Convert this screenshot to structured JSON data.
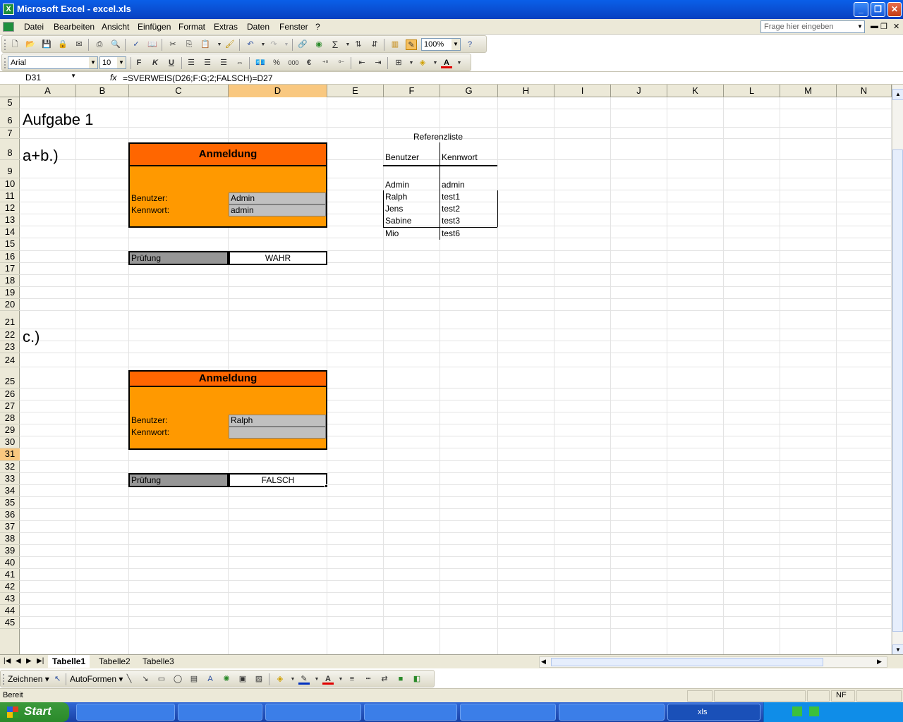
{
  "window": {
    "title": "Microsoft Excel - excel.xls",
    "icon": "excel-icon"
  },
  "menubar": {
    "items": [
      "Datei",
      "Bearbeiten",
      "Ansicht",
      "Einfügen",
      "Format",
      "Extras",
      "Daten",
      "Fenster",
      "?"
    ],
    "help_placeholder": "Frage hier eingeben"
  },
  "toolbar": {
    "zoom": "100%",
    "font": "Arial",
    "size": "10",
    "bold": "F",
    "italic": "K",
    "underline": "U",
    "percent": "%",
    "thousands": "000",
    "euro": "€"
  },
  "formula_bar": {
    "name_box": "D31",
    "fx": "fx",
    "formula": "=SVERWEIS(D26;F:G;2;FALSCH)=D27"
  },
  "columns": [
    "A",
    "B",
    "C",
    "D",
    "E",
    "F",
    "G",
    "H",
    "I",
    "J",
    "K",
    "L",
    "M",
    "N"
  ],
  "active_column": "D",
  "rows": [
    "5",
    "6",
    "7",
    "8",
    "9",
    "10",
    "11",
    "12",
    "13",
    "14",
    "15",
    "16",
    "17",
    "18",
    "19",
    "20",
    "21",
    "22",
    "23",
    "24",
    "25",
    "26",
    "27",
    "28",
    "29",
    "30",
    "31",
    "32",
    "33",
    "34",
    "35",
    "36",
    "37",
    "38",
    "39",
    "40",
    "41",
    "42",
    "43",
    "44",
    "45"
  ],
  "active_row": "31",
  "sheet": {
    "heading": "Aufgabe 1",
    "part_ab": "a+b.)",
    "part_c": "c.)",
    "login1": {
      "title": "Anmeldung",
      "user_label": "Benutzer:",
      "pass_label": "Kennwort:",
      "user_value": "Admin",
      "pass_value": "admin"
    },
    "check1": {
      "label": "Prüfung",
      "value": "WAHR"
    },
    "login2": {
      "title": "Anmeldung",
      "user_label": "Benutzer:",
      "pass_label": "Kennwort:",
      "user_value": "Ralph",
      "pass_value": ""
    },
    "check2": {
      "label": "Prüfung",
      "value": "FALSCH"
    },
    "reference": {
      "title": "Referenzliste",
      "headers": [
        "Benutzer",
        "Kennwort"
      ],
      "rows": [
        [
          "Admin",
          "admin"
        ],
        [
          "Ralph",
          "test1"
        ],
        [
          "Jens",
          "test2"
        ],
        [
          "Sabine",
          "test3"
        ],
        [
          "Mio",
          "test6"
        ]
      ]
    }
  },
  "tabs": [
    "Tabelle1",
    "Tabelle2",
    "Tabelle3"
  ],
  "active_tab": "Tabelle1",
  "draw_toolbar": {
    "draw": "Zeichnen",
    "autoshapes": "AutoFormen"
  },
  "status": {
    "ready": "Bereit",
    "nf": "NF"
  },
  "taskbar": {
    "start": "Start",
    "task_label": "xls"
  },
  "colors": {
    "header_orange": "#ff6600",
    "panel_orange": "#ff9900",
    "input_gray": "#c0c0c0",
    "label_gray": "#969696",
    "active_header": "#f9c880"
  }
}
